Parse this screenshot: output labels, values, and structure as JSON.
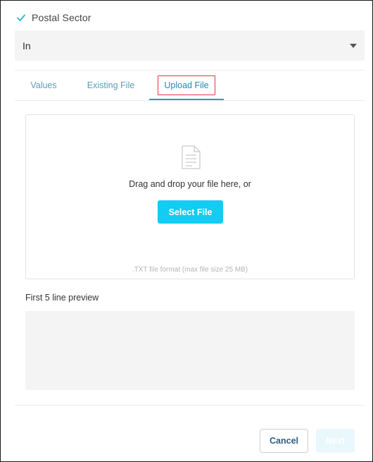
{
  "section": {
    "title": "Postal Sector",
    "icon": "check-icon"
  },
  "operator_select": {
    "value": "In",
    "icon": "caret-down-icon"
  },
  "tabs": [
    {
      "label": "Values",
      "active": false
    },
    {
      "label": "Existing File",
      "active": false
    },
    {
      "label": "Upload File",
      "active": true
    }
  ],
  "dropzone": {
    "icon": "file-document-icon",
    "instruction": "Drag and drop your file here, or",
    "button_label": "Select File",
    "format_hint": ".TXT file format (max file size 25 MB)"
  },
  "preview": {
    "label": "First 5 line preview"
  },
  "footer": {
    "cancel_label": "Cancel",
    "next_label": "Next"
  },
  "colors": {
    "accent": "#13ccf3",
    "tab_active": "#2a86b8",
    "tab_highlight_border": "#e0393e"
  }
}
